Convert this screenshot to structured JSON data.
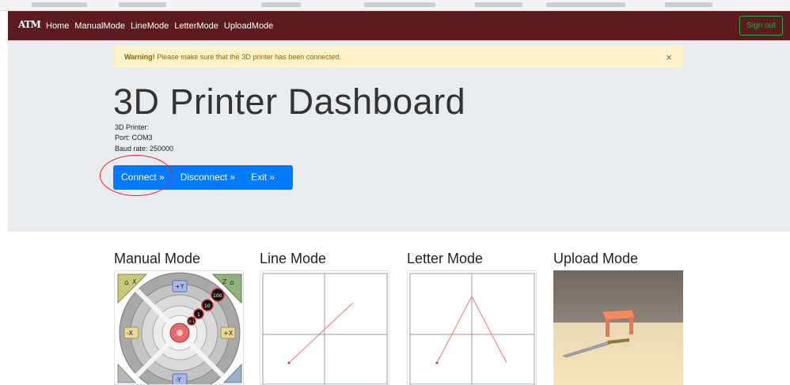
{
  "navbar": {
    "logo": "ATM",
    "links": [
      "Home",
      "ManualMode",
      "LineMode",
      "LetterMode",
      "UploadMode"
    ],
    "signout_label": "Sign out"
  },
  "alert": {
    "strong": "Warning!",
    "message": " Please make sure that the 3D printer has been connected.",
    "close_glyph": "×"
  },
  "dashboard": {
    "title": "3D Printer Dashboard",
    "printer_label": "3D Printer:",
    "port_label": "Port: COM3",
    "baud_label": "Baud rate: 250000",
    "buttons": {
      "connect": "Connect »",
      "disconnect": "Disconnect »",
      "exit": "Exit »"
    }
  },
  "modes": {
    "manual": "Manual Mode",
    "line": "Line Mode",
    "letter": "Letter Mode",
    "upload": "Upload Mode"
  },
  "jog_labels": {
    "home_x": "X",
    "home_z": "Z",
    "plus_y": "+Y",
    "minus_y": "-Y",
    "plus_x": "+X",
    "minus_x": "-X",
    "step_100": "100",
    "step_10": "10",
    "step_1": "1",
    "step_01": "0.1"
  },
  "colors": {
    "navbar": "#5c1c1f",
    "primary": "#007bff",
    "success": "#28a745",
    "warning_bg": "#fff3cd",
    "annotation": "#e0262b"
  }
}
